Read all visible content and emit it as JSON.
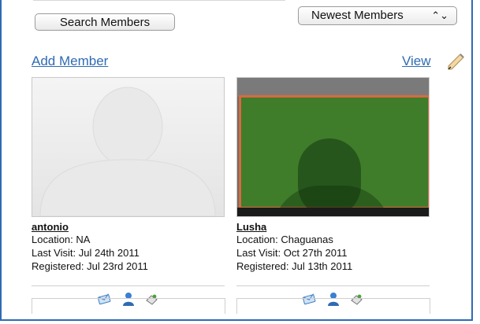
{
  "toolbar": {
    "search_button": "Search Members",
    "sort_select": "Newest Members",
    "sort_arrows": "⌃⌄"
  },
  "links": {
    "add_member": "Add Member",
    "view": "View"
  },
  "members": [
    {
      "name": "antonio",
      "location": "Location: NA",
      "last_visit": "Last Visit: Jul 24th 2011",
      "registered": "Registered: Jul 23rd 2011"
    },
    {
      "name": "Lusha",
      "location": "Location: Chaguanas",
      "last_visit": "Last Visit: Oct 27th 2011",
      "registered": "Registered: Jul 13th 2011"
    }
  ],
  "colors": {
    "link": "#2f6bb3",
    "highlight_overlay": "#3f7d2a",
    "highlight_border": "#d9693f"
  },
  "icons": [
    "message-icon",
    "add-friend-icon",
    "gift-icon"
  ]
}
